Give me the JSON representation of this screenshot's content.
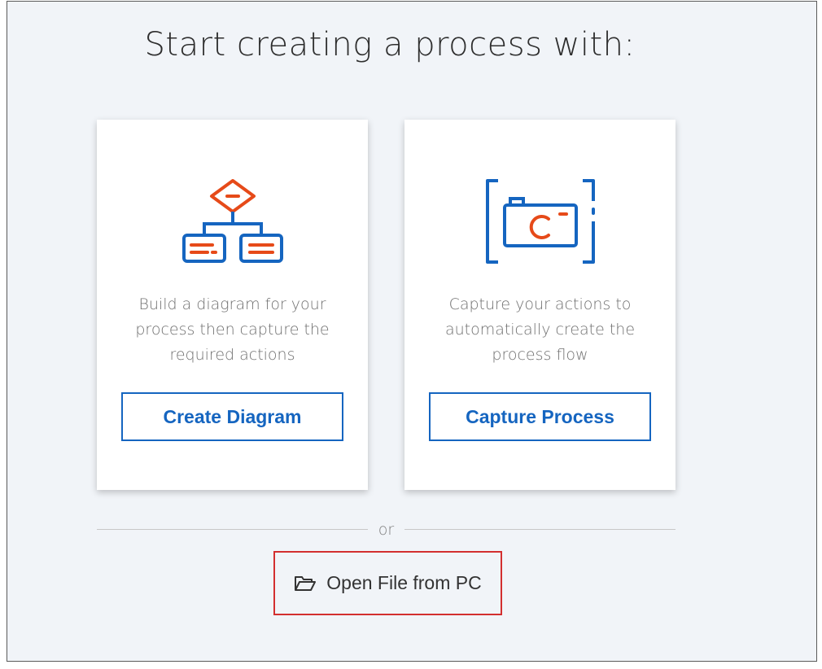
{
  "page": {
    "title": "Start creating a process with:"
  },
  "cards": [
    {
      "icon": "flowchart-icon",
      "description": "Build a diagram for your process then capture the required actions",
      "button_label": "Create Diagram"
    },
    {
      "icon": "camera-capture-icon",
      "description": "Capture your actions to automatically create the process flow",
      "button_label": "Capture Process"
    }
  ],
  "divider": {
    "text": "or"
  },
  "open_file": {
    "icon": "folder-open-icon",
    "label": "Open File from PC"
  },
  "colors": {
    "accent_blue": "#1565c0",
    "accent_orange": "#e64a19",
    "highlight_red": "#d32f2f",
    "background": "#f1f4f8"
  }
}
